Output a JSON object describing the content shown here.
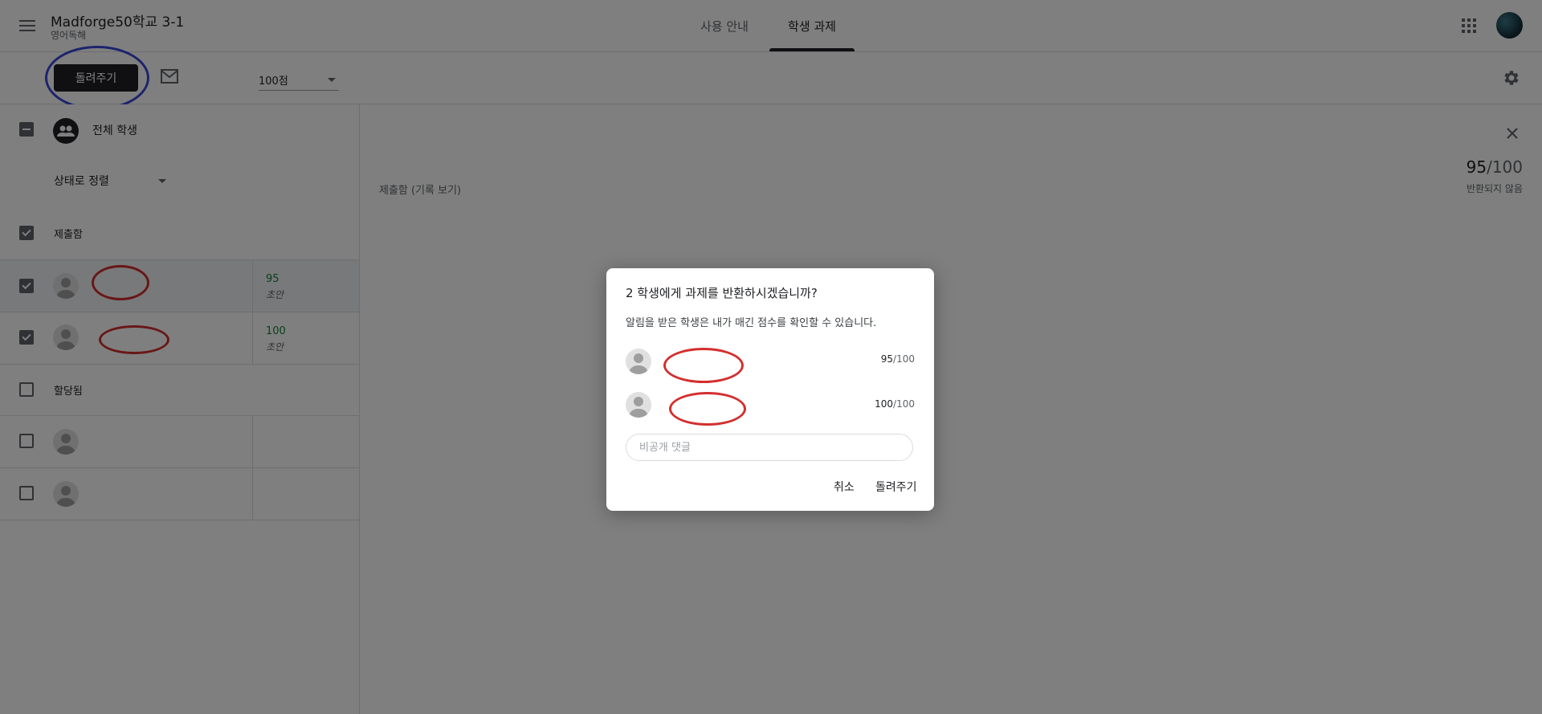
{
  "app": {
    "class_title": "Madforge50학교 3-1",
    "class_subtitle": "영어독해"
  },
  "tabs": [
    {
      "label": "사용 안내",
      "active": false
    },
    {
      "label": "학생 과제",
      "active": true
    }
  ],
  "toolbar": {
    "return_label": "돌려주기",
    "points_value": "100점"
  },
  "left_panel": {
    "all_students_label": "전체 학생",
    "sort_label": "상태로 정렬",
    "sections": {
      "submitted": "제출함",
      "assigned": "할당됨"
    },
    "submitted_students": [
      {
        "grade": "95",
        "status": "초안",
        "checked": true
      },
      {
        "grade": "100",
        "status": "초안",
        "checked": true
      }
    ],
    "assigned_students": [
      {
        "checked": false
      },
      {
        "checked": false
      }
    ]
  },
  "detail": {
    "history_label": "제출함 (기록 보기)",
    "score_numerator": "95",
    "score_denominator": "/100",
    "status_label": "반환되지 않음"
  },
  "dialog": {
    "title": "2 학생에게 과제를 반환하시겠습니까?",
    "description": "알림을 받은 학생은 내가 매긴 점수를 확인할 수 있습니다.",
    "students": [
      {
        "score": "95",
        "max": "/100"
      },
      {
        "score": "100",
        "max": "/100"
      }
    ],
    "comment_placeholder": "비공개 댓글",
    "cancel_label": "취소",
    "confirm_label": "돌려주기"
  },
  "colors": {
    "primary_dark": "#202124",
    "grade_green": "#188038",
    "annotation_blue": "#3c47d8",
    "annotation_red": "#d32f2f"
  }
}
